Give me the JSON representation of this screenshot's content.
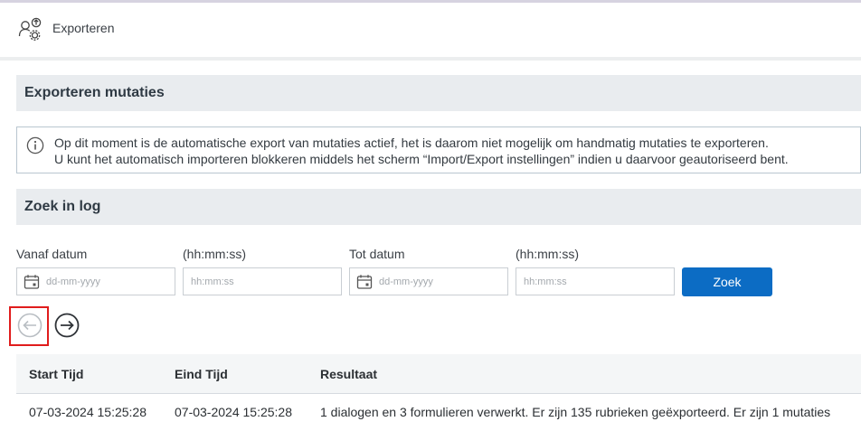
{
  "header": {
    "title": "Exporteren",
    "icon": "user-export-settings-icon"
  },
  "sections": {
    "export_title": "Exporteren mutaties",
    "log_title": "Zoek in log"
  },
  "info": {
    "icon": "info-icon",
    "line1": "Op dit moment is de automatische export van mutaties actief, het is daarom niet mogelijk om handmatig mutaties te exporteren.",
    "line2": "U kunt het automatisch importeren blokkeren middels het scherm “Import/Export instellingen” indien u daarvoor geautoriseerd bent."
  },
  "search": {
    "from_date_label": "Vanaf datum",
    "from_time_label": "(hh:mm:ss)",
    "to_date_label": "Tot datum",
    "to_time_label": "(hh:mm:ss)",
    "date_placeholder": "dd-mm-yyyy",
    "time_placeholder": "hh:mm:ss",
    "from_date_value": "",
    "from_time_value": "",
    "to_date_value": "",
    "to_time_value": "",
    "submit_label": "Zoek"
  },
  "pagination": {
    "prev_icon": "arrow-left-circle-icon",
    "next_icon": "arrow-right-circle-icon",
    "prev_disabled": true
  },
  "table": {
    "columns": [
      "Start Tijd",
      "Eind Tijd",
      "Resultaat"
    ],
    "rows": [
      [
        "07-03-2024 15:25:28",
        "07-03-2024 15:25:28",
        "1 dialogen en 3 formulieren verwerkt. Er zijn 135 rubrieken geëxporteerd. Er zijn 1 mutaties"
      ]
    ]
  },
  "colors": {
    "primary": "#0c6cc4",
    "section_bg": "#e9ecef",
    "highlight": "#e01c1c"
  }
}
